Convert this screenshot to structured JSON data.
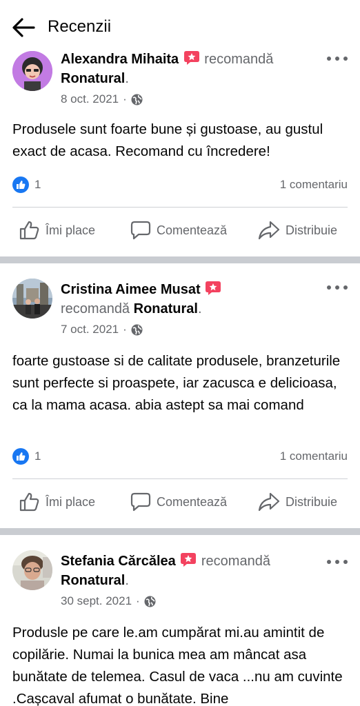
{
  "header": {
    "title": "Recenzii"
  },
  "posts": [
    {
      "author": "Alexandra Mihaita",
      "recommends": "recomandă",
      "page": "Ronatural",
      "date": "8 oct. 2021",
      "text": "Produsele sunt foarte bune și gustoase, au gustul exact de acasa. Recomand cu încredere!",
      "like_count": "1",
      "comments": "1 comentariu"
    },
    {
      "author": "Cristina Aimee Musat",
      "recommends": "recomandă",
      "page": "Ronatural",
      "date": "7 oct. 2021",
      "text": "foarte gustoase si de calitate  produsele, branzeturile sunt perfecte si proaspete, iar zacusca e delicioasa,  ca la mama acasa. abia astept sa mai comand",
      "like_count": "1",
      "comments": "1 comentariu"
    },
    {
      "author": "Stefania Cărcălea",
      "recommends": "recomandă",
      "page": "Ronatural",
      "date": "30 sept. 2021",
      "text": "Produsle pe care le.am cumpărat mi.au amintit de copilărie. Numai la bunica mea am mâncat asa bunătate de telemea. Casul de vaca ...nu am cuvinte .Cașcaval afumat o bunătate. Bine"
    }
  ],
  "actions": {
    "like": "Îmi place",
    "comment": "Comentează",
    "share": "Distribuie"
  },
  "colors": {
    "accent": "#1877f2",
    "badge": "#f3425f",
    "muted": "#65676b",
    "separator": "#c9ccd1"
  }
}
